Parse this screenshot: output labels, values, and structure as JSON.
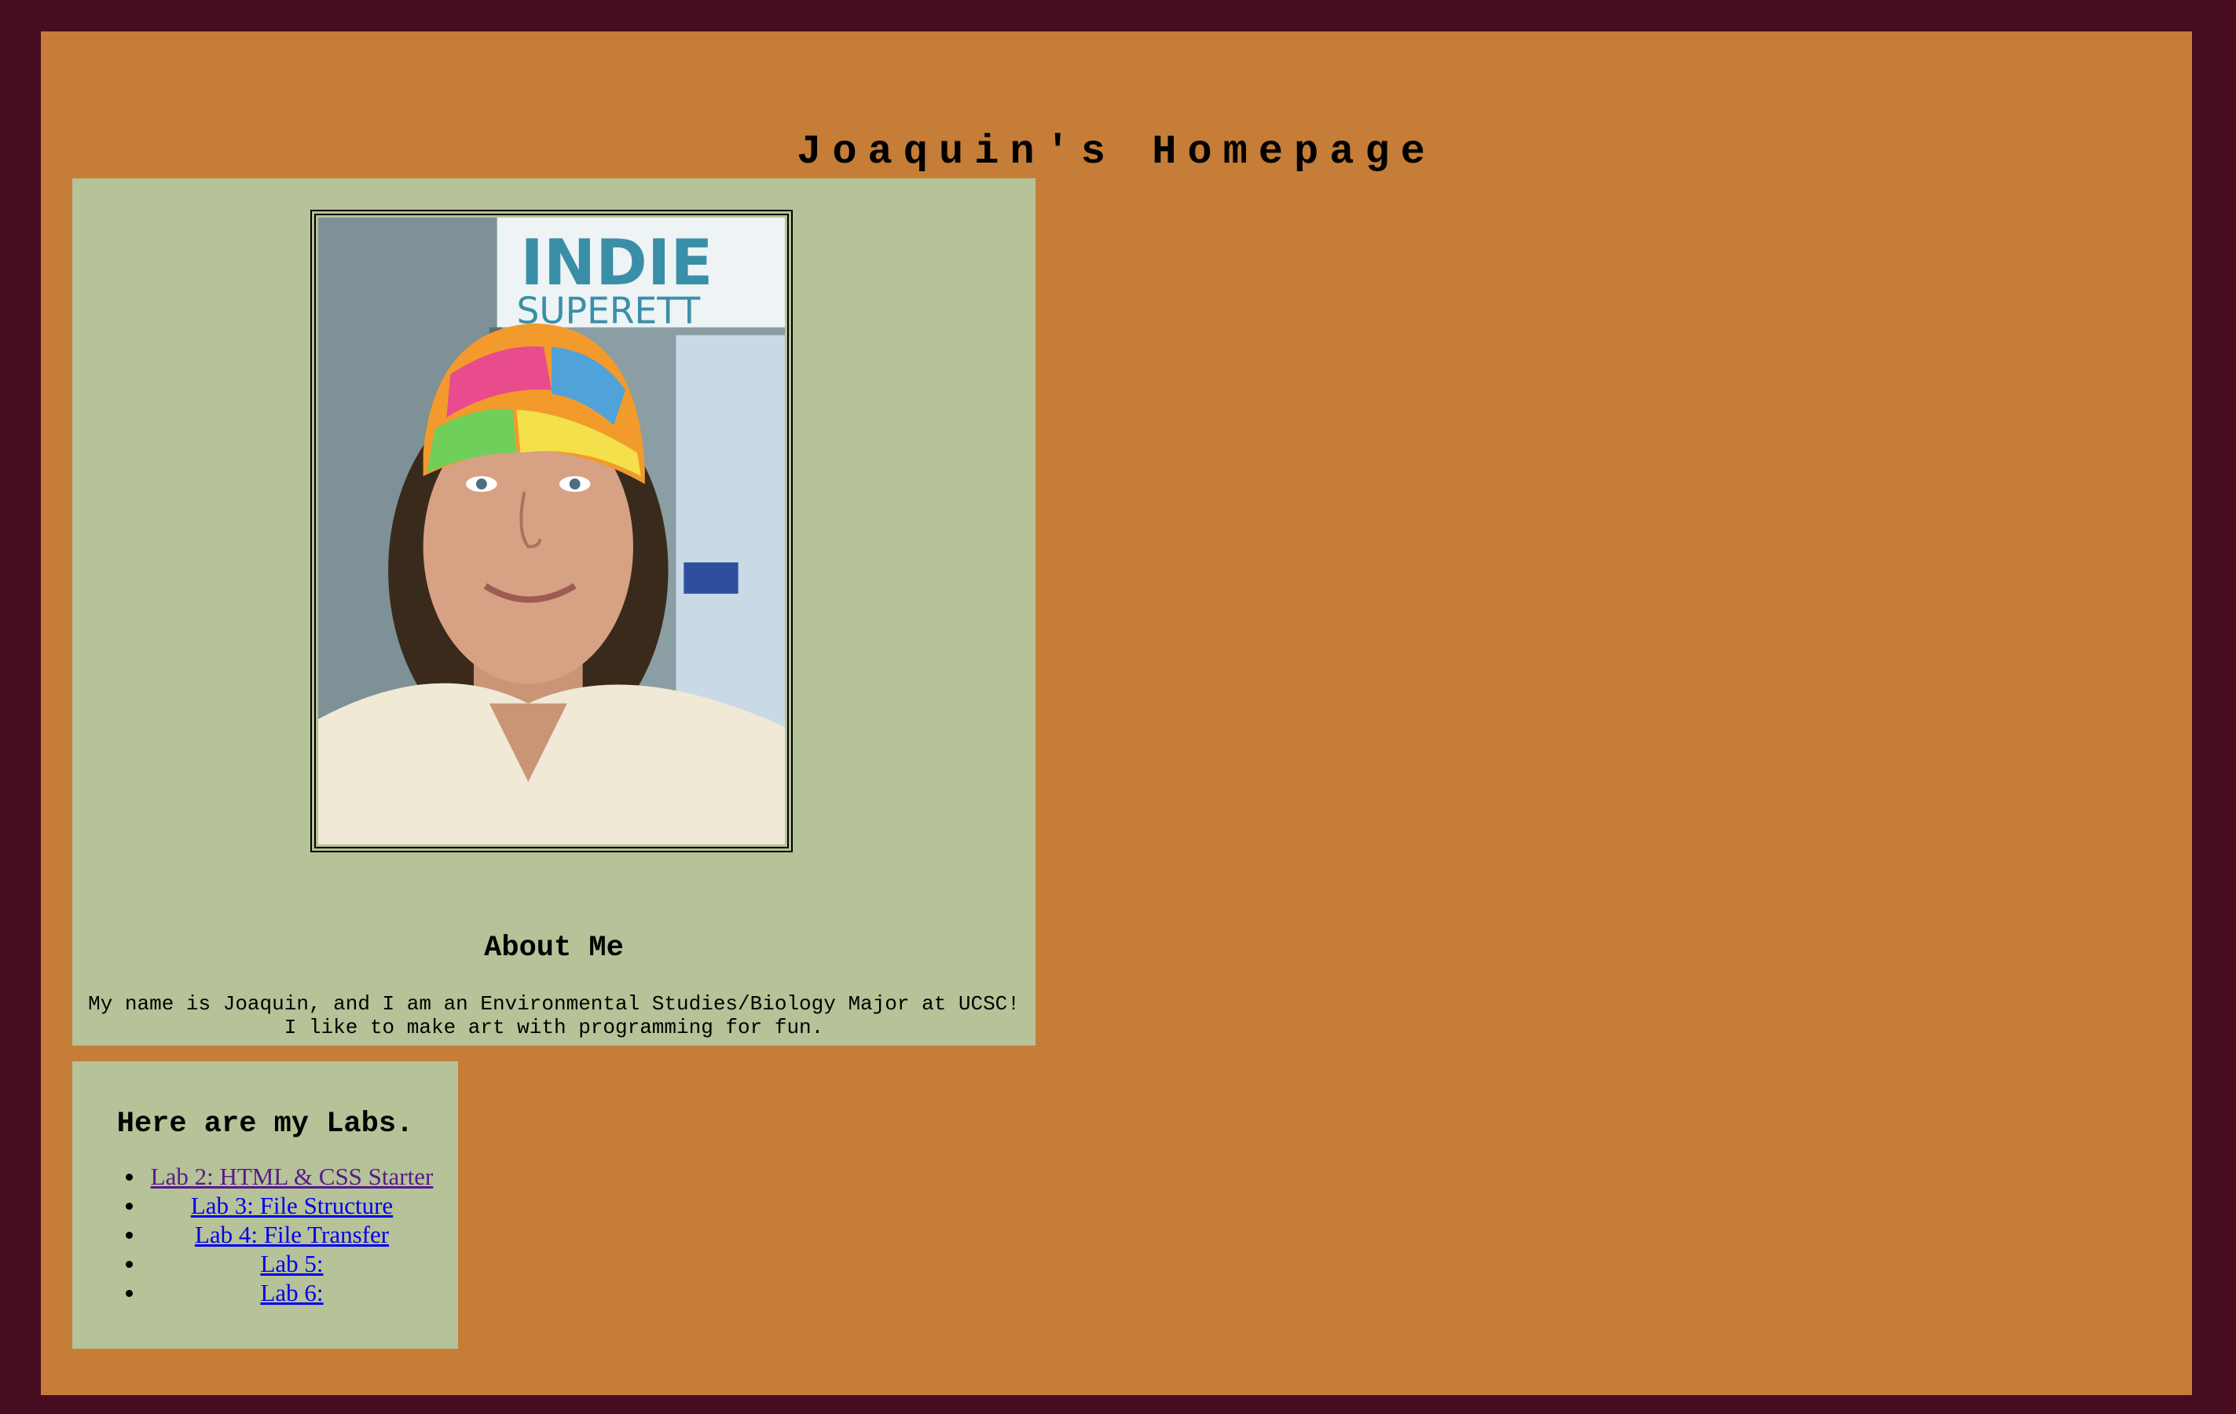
{
  "site": {
    "title": "Joaquin's Homepage"
  },
  "about": {
    "photo_alt": "Photo of Joaquin wearing a colorful knit hat",
    "heading": "About Me",
    "text_line1": "My name is Joaquin, and I am an Environmental Studies/Biology Major at UCSC!",
    "text_line2": "I like to make art with programming for fun."
  },
  "labs": {
    "heading": "Here are my Labs.",
    "items": [
      {
        "label": "Lab 2: HTML & CSS Starter",
        "visited": true
      },
      {
        "label": "Lab 3: File Structure",
        "visited": false
      },
      {
        "label": "Lab 4: File Transfer",
        "visited": false
      },
      {
        "label": "Lab 5:",
        "visited": false
      },
      {
        "label": "Lab 6:",
        "visited": false
      }
    ]
  },
  "colors": {
    "outer_background": "#470c1f",
    "page_background": "#c57d38",
    "card_background": "#b6c297",
    "link": "#0000ee",
    "link_visited": "#551a8b"
  }
}
